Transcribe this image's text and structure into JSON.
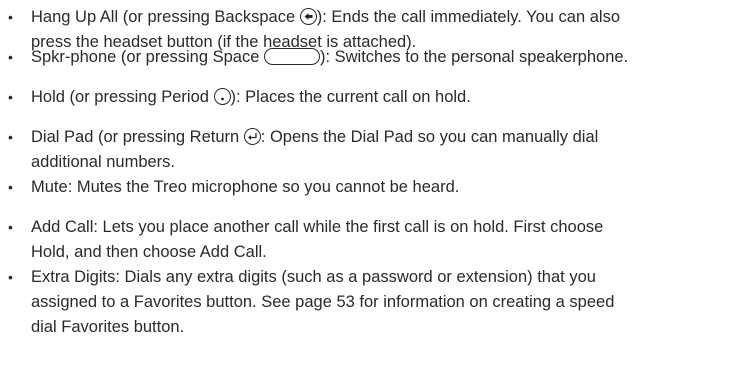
{
  "items": [
    {
      "term": "Hang Up All",
      "lines": [
        [
          {
            "t": "t",
            "v": " (or pressing Backspace "
          },
          {
            "t": "key",
            "k": "backspace"
          },
          {
            "t": "t",
            "v": "): Ends the call immediately. You can also"
          }
        ],
        [
          {
            "t": "t",
            "v": "press the headset button (if the headset is attached)."
          }
        ]
      ]
    },
    {
      "term": "Spkr-phone",
      "lines": [
        [
          {
            "t": "t",
            "v": " (or pressing Space "
          },
          {
            "t": "key",
            "k": "space"
          },
          {
            "t": "t",
            "v": "): Switches to the personal speakerphone."
          }
        ]
      ]
    },
    {
      "term": "Hold",
      "lines": [
        [
          {
            "t": "t",
            "v": " (or pressing Period "
          },
          {
            "t": "key",
            "k": "period"
          },
          {
            "t": "t",
            "v": "): Places the current call on hold."
          }
        ]
      ]
    },
    {
      "term": "Dial Pad (or pressing Return",
      "lines": [
        [
          {
            "t": "t",
            "v": " "
          },
          {
            "t": "key",
            "k": "return"
          },
          {
            "t": "t",
            "v": ": Opens the Dial Pad so you can manually dial"
          }
        ],
        [
          {
            "t": "t",
            "v": "additional numbers."
          }
        ]
      ]
    },
    {
      "term": "Mute",
      "lines": [
        [
          {
            "t": "t",
            "v": ": Mutes the Treo microphone so you cannot be heard."
          }
        ]
      ]
    },
    {
      "term": "Add Call",
      "lines": [
        [
          {
            "t": "t",
            "v": ": Lets you place another call while the first call is on hold. First choose"
          }
        ],
        [
          {
            "t": "t",
            "v": "Hold, and then choose Add Call."
          }
        ]
      ]
    },
    {
      "term": "Extra Digits",
      "lines": [
        [
          {
            "t": "t",
            "v": ": Dials any extra digits (such as a password or extension) that you"
          }
        ],
        [
          {
            "t": "t",
            "v": "assigned to a Favorites button. See page 53 for information on creating a speed"
          }
        ],
        [
          {
            "t": "t",
            "v": "dial Favorites button."
          }
        ]
      ]
    }
  ],
  "icons": {
    "backspace": "backspace-key-icon",
    "space": "space-key-icon",
    "period": "period-key-icon",
    "return": "return-key-icon"
  }
}
